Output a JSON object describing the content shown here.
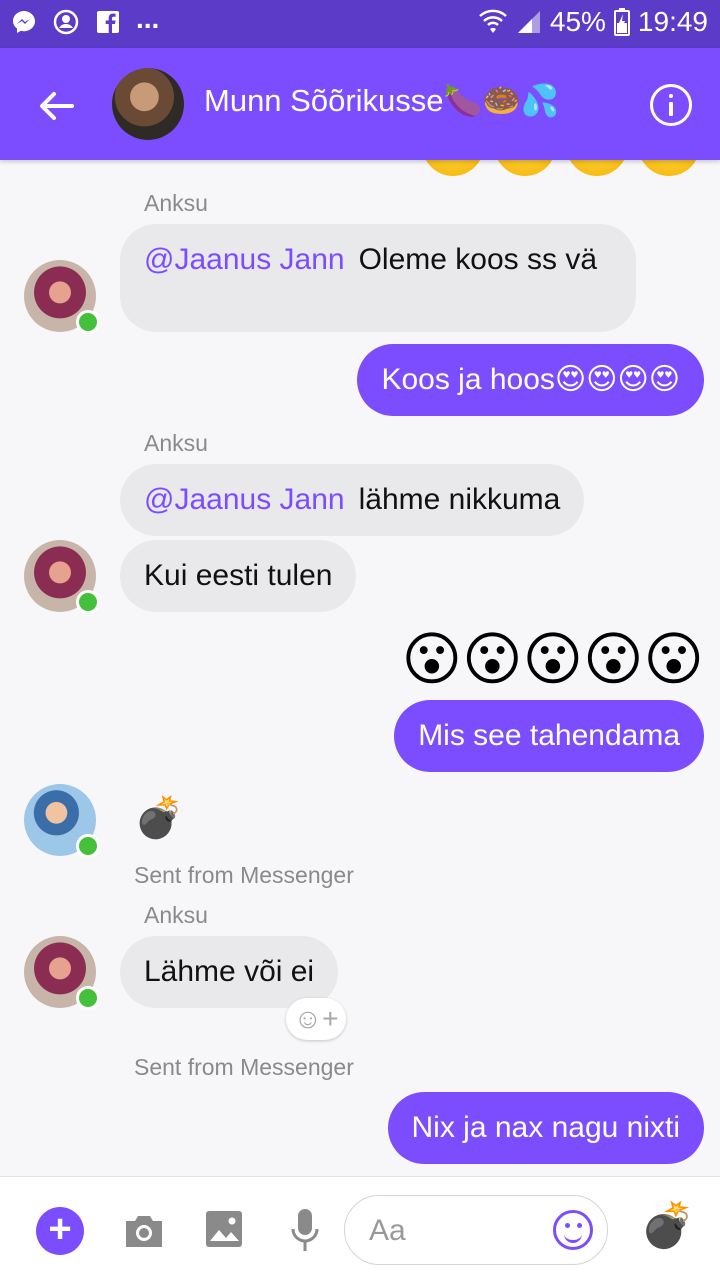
{
  "statusbar": {
    "battery": "45%",
    "time": "19:49"
  },
  "header": {
    "title": "Munn Sõõrikusse🍆🍩💦"
  },
  "messages": {
    "m1": {
      "sender": "Anksu",
      "mention": "@Jaanus Jann",
      "text": "Oleme koos ss vä"
    },
    "m2": {
      "text": "Koos ja hoos😍😍😍😍"
    },
    "m3": {
      "sender": "Anksu",
      "mention": "@Jaanus Jann",
      "text": "lähme nikkuma"
    },
    "m4": {
      "text": "Kui eesti tulen"
    },
    "m5": {
      "emojis": "😮😮😮😮😮"
    },
    "m6": {
      "text": "Mis see tahendama"
    },
    "m7": {
      "emoji": "💣",
      "footer": "Sent from Messenger"
    },
    "m8": {
      "sender": "Anksu",
      "text": "Lähme või ei",
      "footer": "Sent from Messenger"
    },
    "m9": {
      "text": "Nix ja nax nagu nixti"
    }
  },
  "composer": {
    "placeholder": "Aa",
    "quick_emoji": "💣"
  }
}
